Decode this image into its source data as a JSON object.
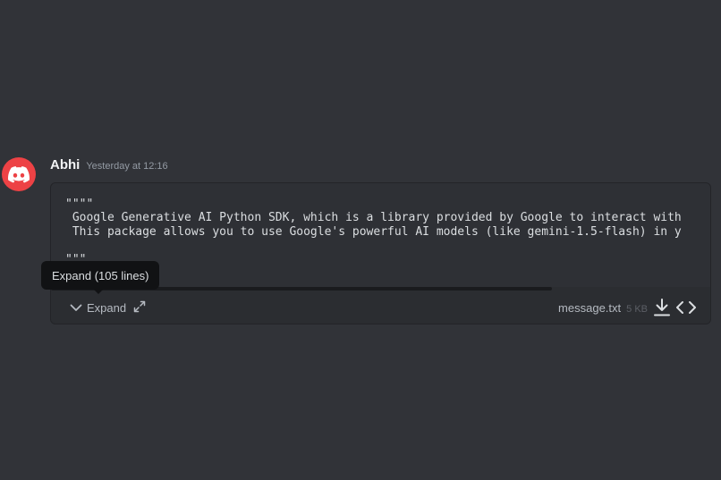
{
  "message": {
    "author": "Abhi",
    "timestamp": "Yesterday at 12:16",
    "avatar_icon": "discord-logo-icon",
    "avatar_color": "#ed4245"
  },
  "attachment": {
    "lines": [
      "\"\"\"\"",
      " Google Generative AI Python SDK, which is a library provided by Google to interact with",
      " This package allows you to use Google's powerful AI models (like gemini-1.5-flash) in y",
      "",
      "\"\"\""
    ],
    "expand_label": "Expand",
    "file_name": "message.txt",
    "file_size": "5 KB",
    "icons": {
      "expand": "chevron-down-icon",
      "fullscreen": "expand-arrows-icon",
      "download": "download-icon",
      "source": "code-icon"
    }
  },
  "tooltip": {
    "text": "Expand (105 lines)"
  },
  "colors": {
    "background": "#313338",
    "attachment_bg": "#2b2d31",
    "tooltip_bg": "#111214"
  }
}
